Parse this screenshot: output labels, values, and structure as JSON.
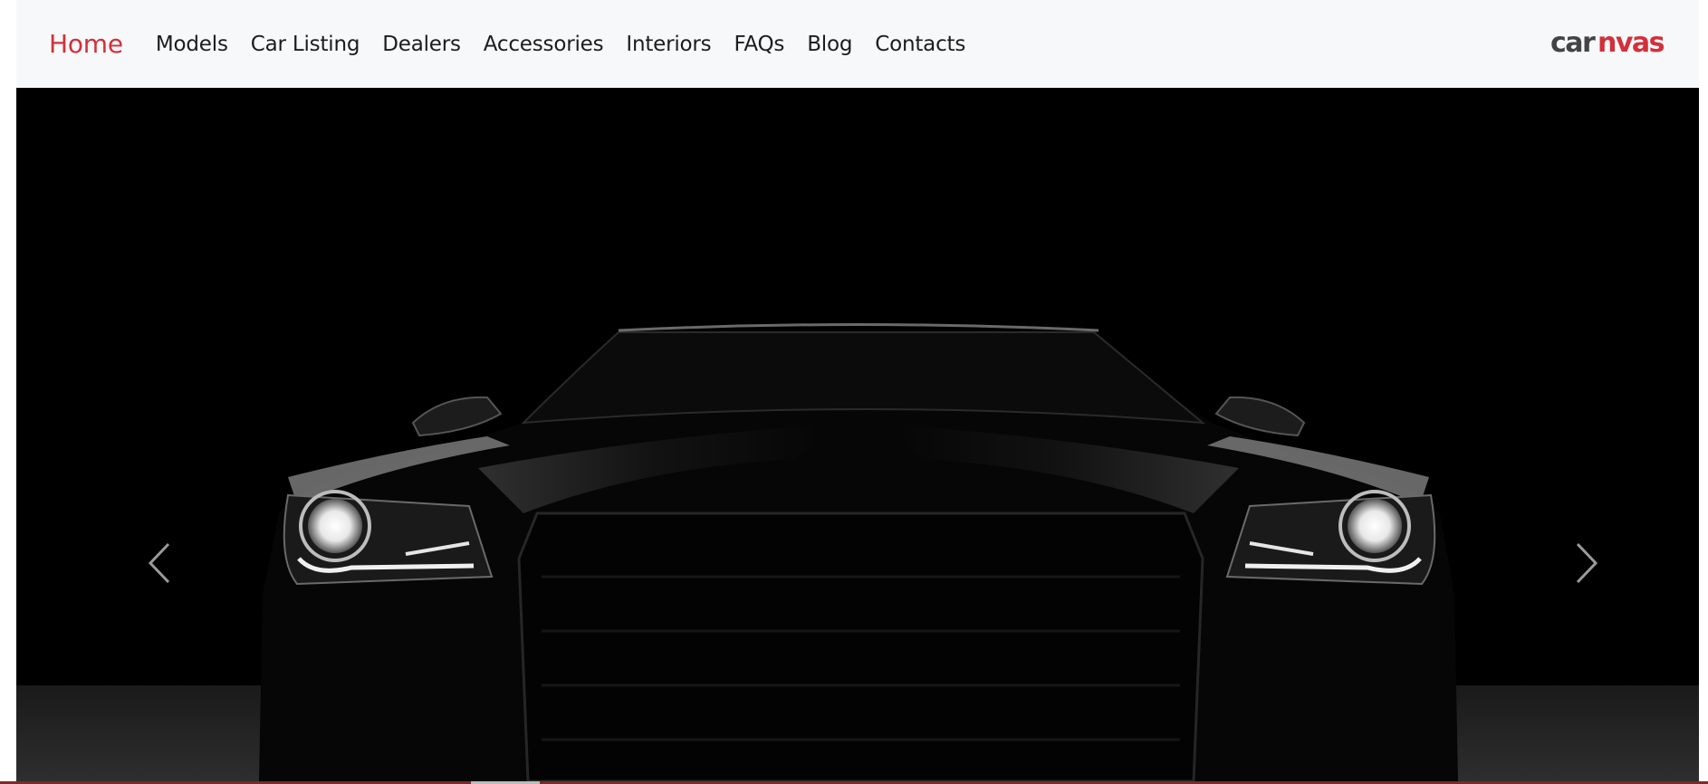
{
  "nav": {
    "items": [
      {
        "label": "Home",
        "active": true
      },
      {
        "label": "Models"
      },
      {
        "label": "Car Listing"
      },
      {
        "label": "Dealers"
      },
      {
        "label": "Accessories"
      },
      {
        "label": "Interiors"
      },
      {
        "label": "FAQs"
      },
      {
        "label": "Blog"
      },
      {
        "label": "Contacts"
      }
    ]
  },
  "logo": {
    "text_dark": "car",
    "text_accent": "nvas",
    "accent_color": "#d2303a",
    "dark_color": "#444444"
  },
  "slider": {
    "prev_icon": "chevron-left-icon",
    "next_icon": "chevron-right-icon"
  },
  "colors": {
    "accent": "#d2303a",
    "header_bg": "#f7f8fa",
    "hero_bg": "#000000"
  }
}
